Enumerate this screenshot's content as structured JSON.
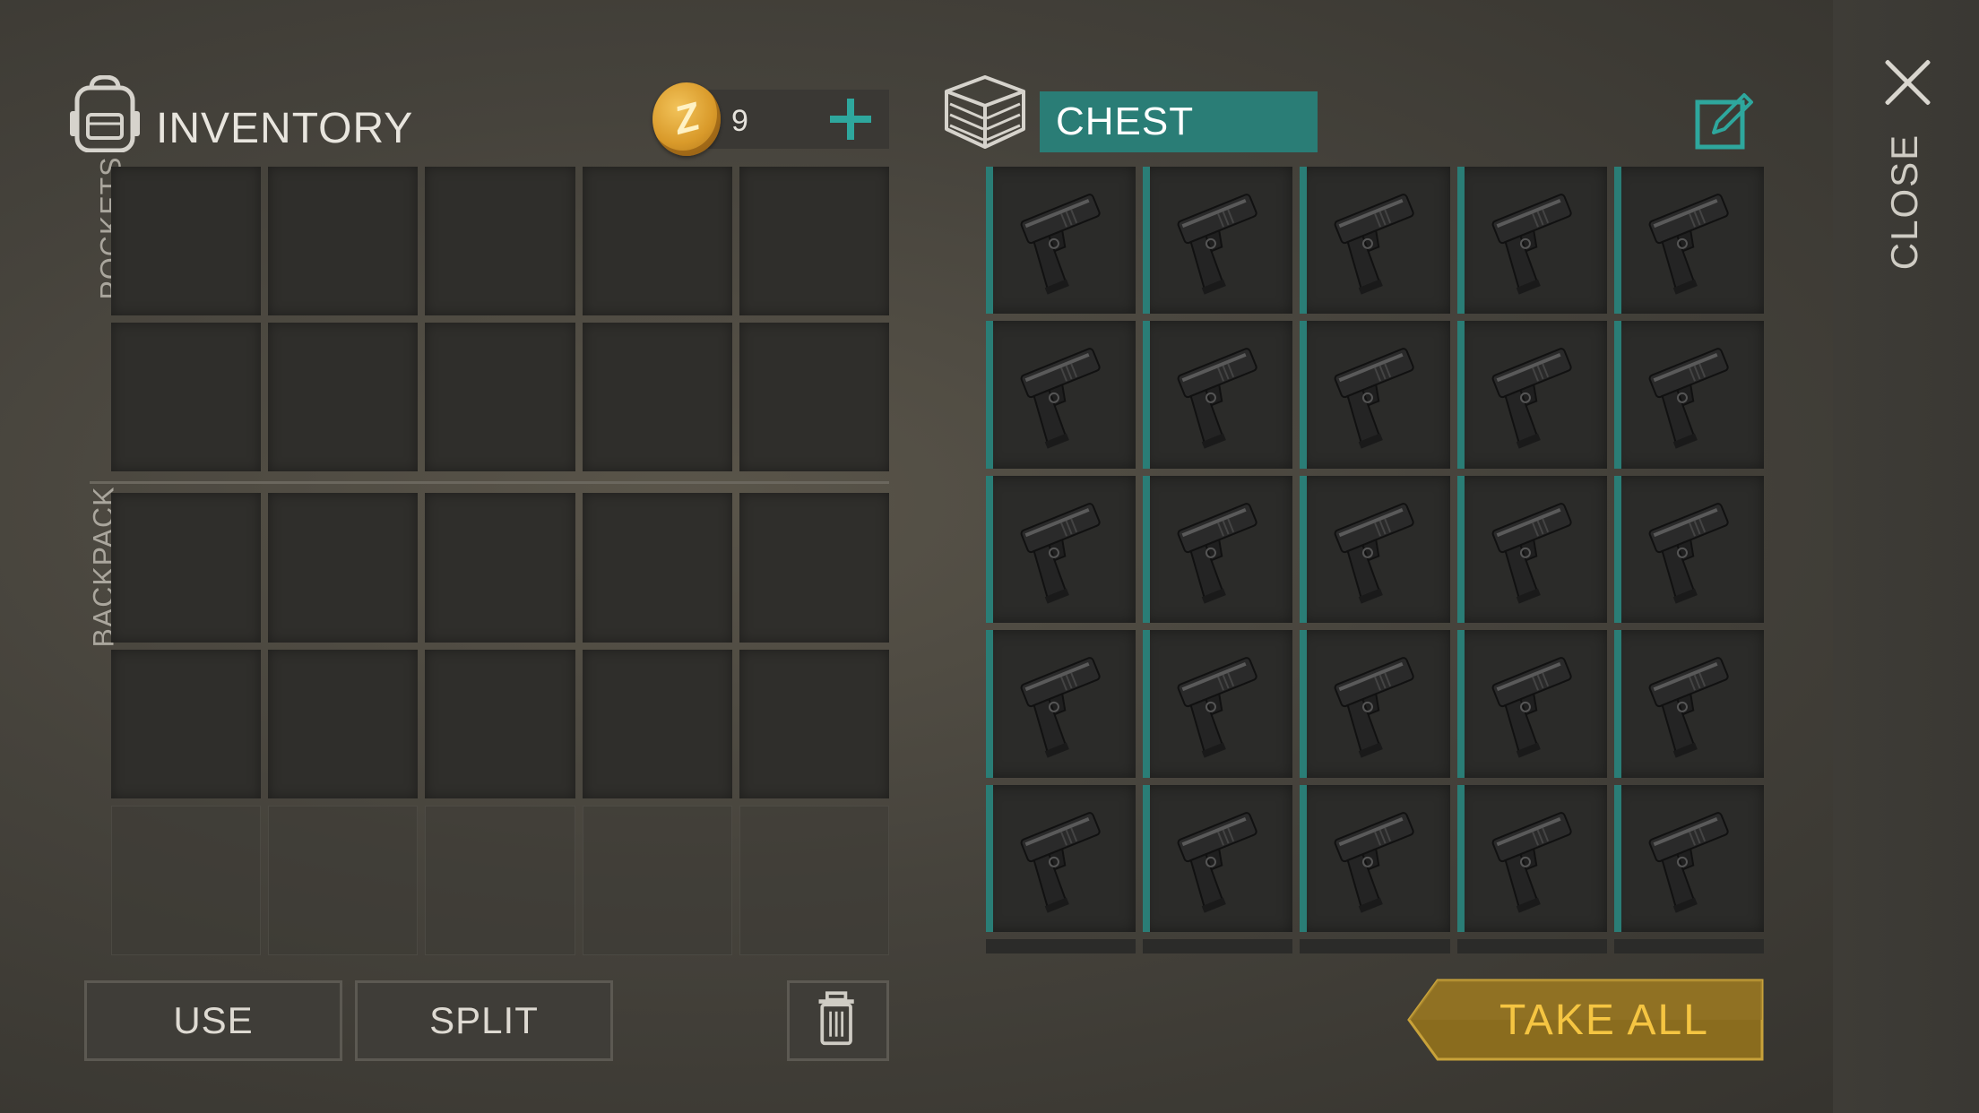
{
  "inventory": {
    "title": "INVENTORY",
    "icon": "backpack-icon",
    "coins": {
      "icon": "coin-icon",
      "symbol": "Z",
      "count": "9",
      "add_icon": "plus-icon"
    },
    "sections": {
      "pockets": "POCKETS",
      "backpack": "BACKPACK"
    }
  },
  "chest": {
    "title": "CHEST",
    "icon": "crate-icon",
    "edit_icon": "edit-icon",
    "item_icon": "pistol-icon",
    "item_count": 25
  },
  "close": {
    "label": "CLOSE",
    "icon": "close-icon"
  },
  "actions": {
    "use": "USE",
    "split": "SPLIT",
    "trash_icon": "trash-icon",
    "take_all": "TAKE ALL"
  },
  "colors": {
    "accent_teal": "#2a7d76",
    "take_all_gold": "#f5c542",
    "coin_gold": "#d99a2a"
  }
}
